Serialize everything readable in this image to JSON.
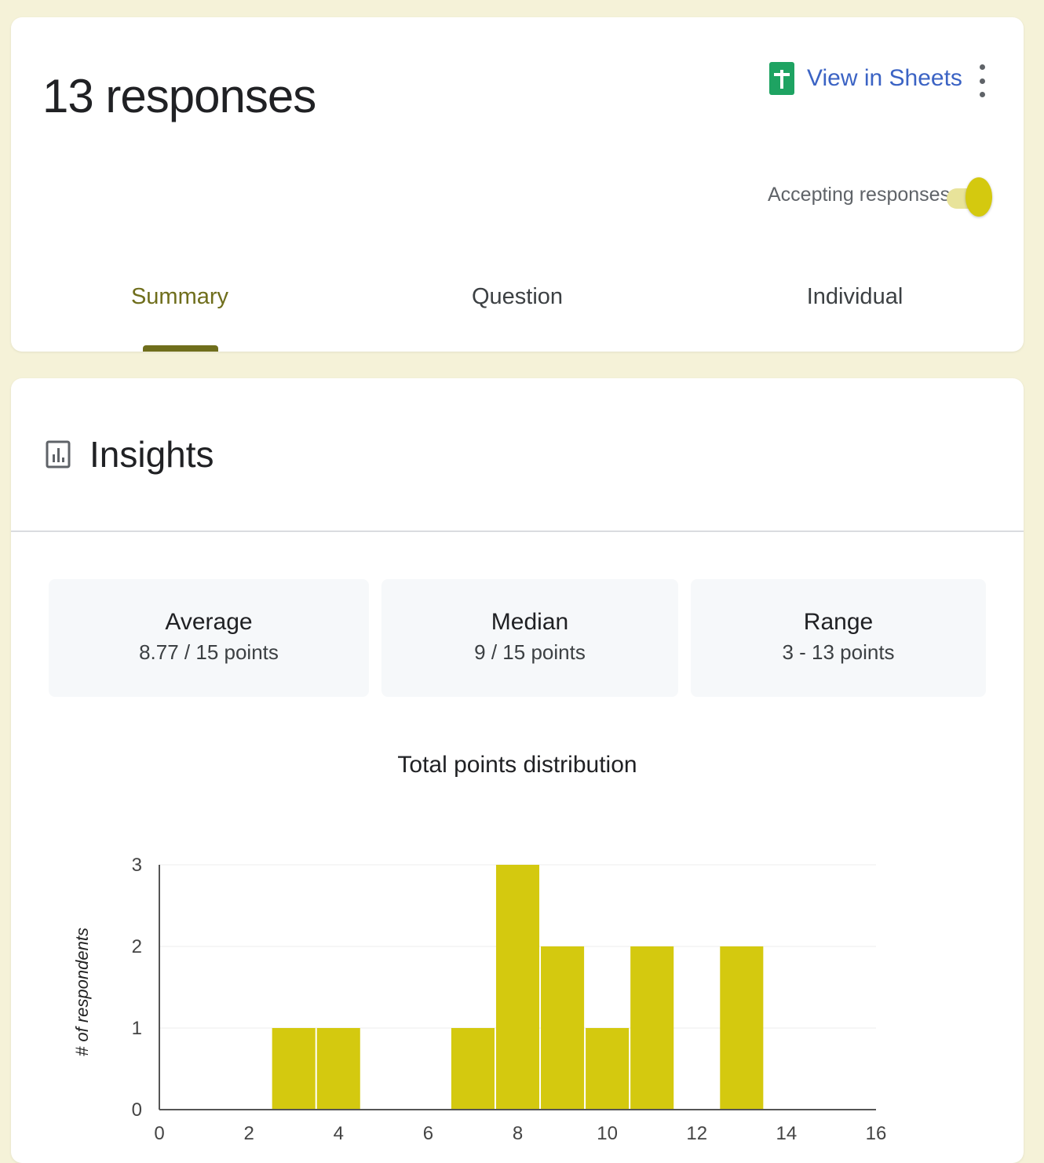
{
  "header": {
    "title": "13 responses",
    "view_in_sheets": "View in Sheets",
    "accepting_label": "Accepting responses",
    "accepting_on": true
  },
  "tabs": [
    {
      "label": "Summary",
      "active": true
    },
    {
      "label": "Question",
      "active": false
    },
    {
      "label": "Individual",
      "active": false
    }
  ],
  "insights": {
    "title": "Insights",
    "stats": [
      {
        "label": "Average",
        "value": "8.77 / 15 points"
      },
      {
        "label": "Median",
        "value": "9 / 15 points"
      },
      {
        "label": "Range",
        "value": "3 - 13 points"
      }
    ]
  },
  "colors": {
    "accent": "#6f6e1c",
    "bar": "#d4c90f",
    "sheets_green": "#1ea362",
    "link_blue": "#3b63c4"
  },
  "icons": {
    "sheets": "google-sheets-icon",
    "more": "more-vert-icon",
    "insights": "bar-chart-icon"
  },
  "chart_data": {
    "type": "bar",
    "title": "Total points distribution",
    "xlabel": "",
    "ylabel": "# of respondents",
    "x": [
      3,
      4,
      7,
      8,
      9,
      10,
      11,
      13
    ],
    "values": [
      1,
      1,
      1,
      3,
      2,
      1,
      2,
      2
    ],
    "xlim": [
      0,
      16
    ],
    "ylim": [
      0,
      3
    ],
    "x_ticks": [
      0,
      2,
      4,
      6,
      8,
      10,
      12,
      14,
      16
    ],
    "y_ticks": [
      0,
      1,
      2,
      3
    ],
    "grid": true,
    "legend": "none"
  }
}
